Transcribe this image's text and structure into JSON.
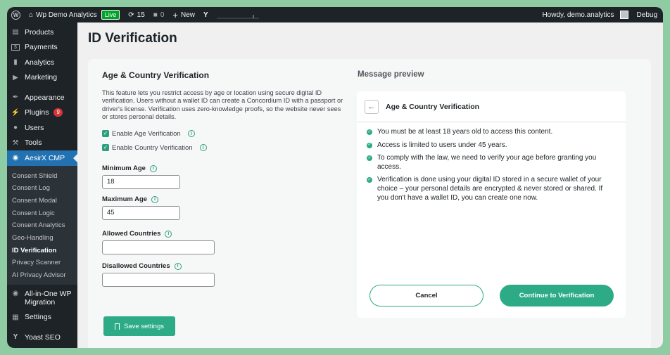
{
  "adminbar": {
    "site_name": "Wp Demo Analytics",
    "live_label": "Live",
    "updates_count": "15",
    "comments_count": "0",
    "new_label": "New",
    "howdy": "Howdy, demo.analytics",
    "debug_label": "Debug"
  },
  "sidebar": {
    "items_top": [
      {
        "label": "Products",
        "icon": "products-icon"
      },
      {
        "label": "Payments",
        "icon": "payments-icon"
      },
      {
        "label": "Analytics",
        "icon": "analytics-icon"
      },
      {
        "label": "Marketing",
        "icon": "marketing-icon"
      },
      {
        "label": "Appearance",
        "icon": "appearance-icon"
      },
      {
        "label": "Plugins",
        "icon": "plugins-icon",
        "badge": "9"
      },
      {
        "label": "Users",
        "icon": "users-icon"
      },
      {
        "label": "Tools",
        "icon": "tools-icon"
      }
    ],
    "active_item": "AesirX CMP",
    "submenu": [
      "Consent Shield",
      "Consent Log",
      "Consent Modal",
      "Consent Logic",
      "Consent Analytics",
      "Geo-Handling",
      "ID Verification",
      "Privacy Scanner",
      "AI Privacy Advisor"
    ],
    "items_bottom": [
      {
        "label": "All-in-One WP Migration",
        "icon": "migration-icon"
      },
      {
        "label": "Settings",
        "icon": "settings-icon"
      },
      {
        "label": "Yoast SEO",
        "icon": "yoast-icon"
      }
    ]
  },
  "page": {
    "title": "ID Verification"
  },
  "settings": {
    "heading": "Age & Country Verification",
    "description": "This feature lets you restrict access by age or location using secure digital ID verification. Users without a wallet ID can create a Concordium ID with a passport or driver's license. Verification uses zero-knowledge proofs, so the website never sees or stores personal details.",
    "enable_age_label": "Enable Age Verification",
    "enable_country_label": "Enable Country Verification",
    "min_age_label": "Minimum Age",
    "min_age_value": "18",
    "max_age_label": "Maximum Age",
    "max_age_value": "45",
    "allowed_countries_label": "Allowed Countries",
    "allowed_countries_value": "",
    "disallowed_countries_label": "Disallowed Countries",
    "disallowed_countries_value": "",
    "save_label": "Save settings"
  },
  "preview": {
    "section_title": "Message preview",
    "card_title": "Age & Country Verification",
    "items": [
      "You must be at least 18 years old to access this content.",
      "Access is limited to users under 45 years.",
      "To comply with the law, we need to verify your age before granting you access.",
      "Verification is done using your digital ID stored in a secure wallet of your choice – your personal details are encrypted & never stored or shared. If you don't have a wallet ID, you can create one now."
    ],
    "cancel_label": "Cancel",
    "continue_label": "Continue to Verification"
  },
  "colors": {
    "accent": "#2dab87",
    "admin_dark": "#1d2327",
    "active_menu": "#2271b1",
    "frame_bg": "#8fcca3"
  }
}
